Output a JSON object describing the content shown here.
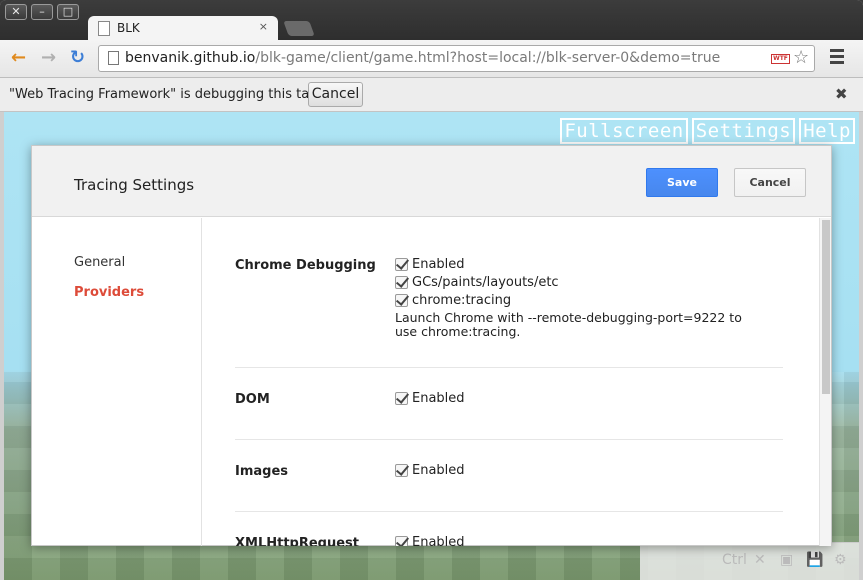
{
  "browser": {
    "window_buttons": [
      "✕",
      "–",
      "□"
    ],
    "tab_title": "BLK",
    "tab_close": "×",
    "url_host": "benvanik.github.io",
    "url_path": "/blk-game/client/game.html?host=local://blk-server-0&demo=true",
    "wtf_badge": "WTF",
    "nav_icons": {
      "back": "←",
      "forward": "→",
      "reload": "↻",
      "star": "☆"
    }
  },
  "infobar": {
    "message": "\"Web Tracing Framework\" is debugging this tab.",
    "cancel_label": "Cancel",
    "close_glyph": "✖"
  },
  "game": {
    "nav": [
      "Fullscreen",
      "Settings",
      "Help"
    ],
    "hud": [
      "Ctrl",
      "✕",
      "▣",
      "💾",
      "⚙"
    ]
  },
  "dialog": {
    "title": "Tracing Settings",
    "save_label": "Save",
    "cancel_label": "Cancel",
    "sidebar": [
      {
        "label": "General",
        "active": false
      },
      {
        "label": "Providers",
        "active": true
      }
    ],
    "sections": [
      {
        "name": "Chrome Debugging",
        "options": [
          "Enabled",
          "GCs/paints/layouts/etc",
          "chrome:tracing"
        ],
        "note": "Launch Chrome with --remote-debugging-port=9222 to use chrome:tracing."
      },
      {
        "name": "DOM",
        "options": [
          "Enabled"
        ]
      },
      {
        "name": "Images",
        "options": [
          "Enabled"
        ]
      },
      {
        "name": "XMLHttpRequest",
        "options": [
          "Enabled"
        ]
      }
    ]
  },
  "colors": {
    "accent_blue": "#4d90fe",
    "active_nav_red": "#dd4b39",
    "sky": "#aee4f4"
  }
}
